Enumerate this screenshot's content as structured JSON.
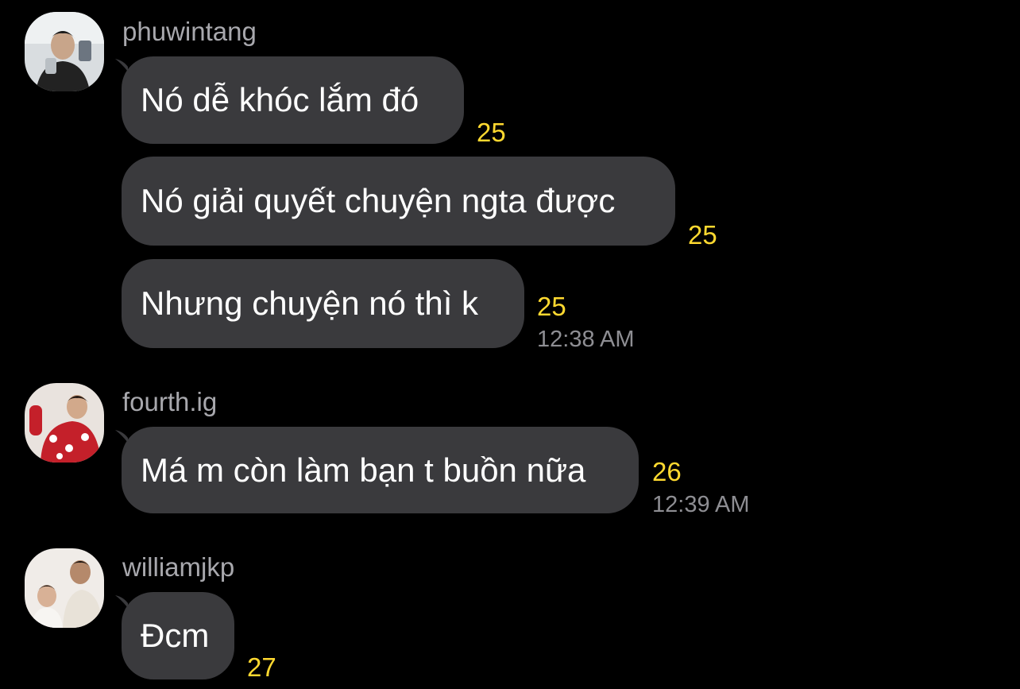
{
  "colors": {
    "background": "#000000",
    "bubble": "#3a3a3d",
    "username": "#a8a8ad",
    "read_count": "#ffd930",
    "timestamp": "#8e8e93"
  },
  "groups": [
    {
      "username": "phuwintang",
      "avatar_icon": "user-avatar-phuwintang",
      "messages": [
        {
          "text": "Nó dễ khóc lắm đó",
          "read_count": "25"
        },
        {
          "text": "Nó giải quyết chuyện ngta được",
          "read_count": "25"
        },
        {
          "text": "Nhưng chuyện nó thì k",
          "read_count": "25",
          "time": "12:38 AM"
        }
      ]
    },
    {
      "username": "fourth.ig",
      "avatar_icon": "user-avatar-fourth",
      "messages": [
        {
          "text": "Má m còn làm bạn t buồn nữa",
          "read_count": "26",
          "time": "12:39 AM"
        }
      ]
    },
    {
      "username": "williamjkp",
      "avatar_icon": "user-avatar-williamjkp",
      "messages": [
        {
          "text": "Đcm",
          "read_count": "27"
        }
      ]
    }
  ]
}
